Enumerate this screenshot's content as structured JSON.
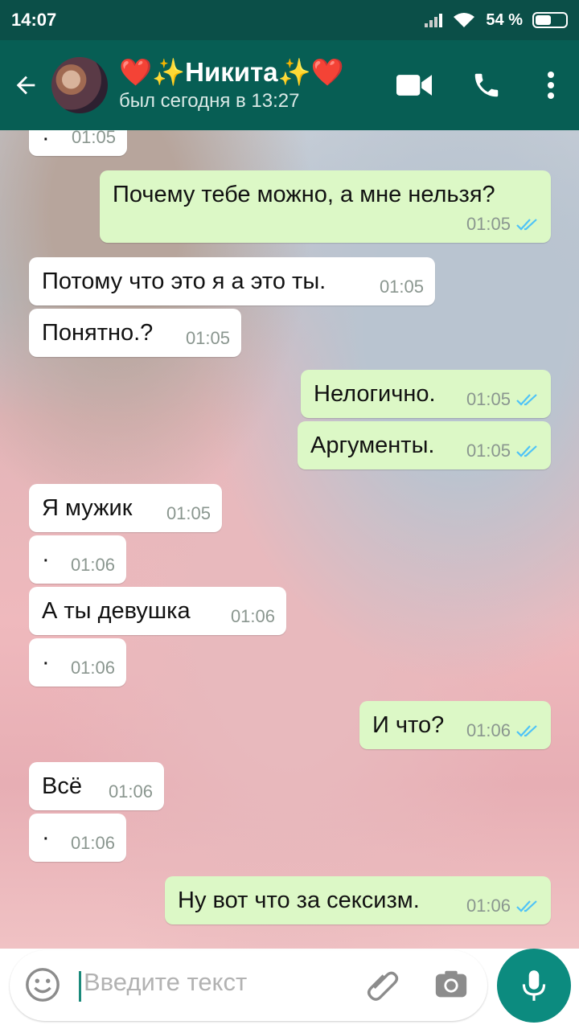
{
  "status_bar": {
    "time": "14:07",
    "battery": "54 %",
    "battery_level": 0.54
  },
  "header": {
    "contact_name": "❤️✨Никита✨❤️",
    "last_seen": "был сегодня в 13:27"
  },
  "messages": [
    {
      "dir": "in",
      "text": "·",
      "time": "01:05",
      "read": false
    },
    {
      "dir": "out",
      "text": "Почему тебе можно, а мне нельзя?",
      "time": "01:05",
      "read": true
    },
    {
      "dir": "in",
      "text": "Потому что это я а это ты.",
      "time": "01:05",
      "read": false
    },
    {
      "dir": "in",
      "text": "Понятно.?",
      "time": "01:05",
      "read": false
    },
    {
      "dir": "out",
      "text": "Нелогично.",
      "time": "01:05",
      "read": true
    },
    {
      "dir": "out",
      "text": "Аргументы.",
      "time": "01:05",
      "read": true
    },
    {
      "dir": "in",
      "text": "Я мужик",
      "time": "01:05",
      "read": false
    },
    {
      "dir": "in",
      "text": "·",
      "time": "01:06",
      "read": false
    },
    {
      "dir": "in",
      "text": "А ты девушка",
      "time": "01:06",
      "read": false
    },
    {
      "dir": "in",
      "text": "·",
      "time": "01:06",
      "read": false
    },
    {
      "dir": "out",
      "text": "И что?",
      "time": "01:06",
      "read": true
    },
    {
      "dir": "in",
      "text": "Всё",
      "time": "01:06",
      "read": false
    },
    {
      "dir": "in",
      "text": "·",
      "time": "01:06",
      "read": false
    },
    {
      "dir": "out",
      "text": "Ну вот что за сексизм.",
      "time": "01:06",
      "read": true
    }
  ],
  "input": {
    "placeholder": "Введите текст"
  },
  "colors": {
    "header": "#075e54",
    "outgoing": "#dcf8c6",
    "incoming": "#ffffff",
    "read_tick": "#4fc3f7",
    "mic": "#0c8b7f"
  },
  "icons": [
    "back-arrow-icon",
    "video-call-icon",
    "phone-icon",
    "more-vert-icon",
    "emoji-icon",
    "attach-icon",
    "camera-icon",
    "mic-icon",
    "scroll-down-icon"
  ]
}
